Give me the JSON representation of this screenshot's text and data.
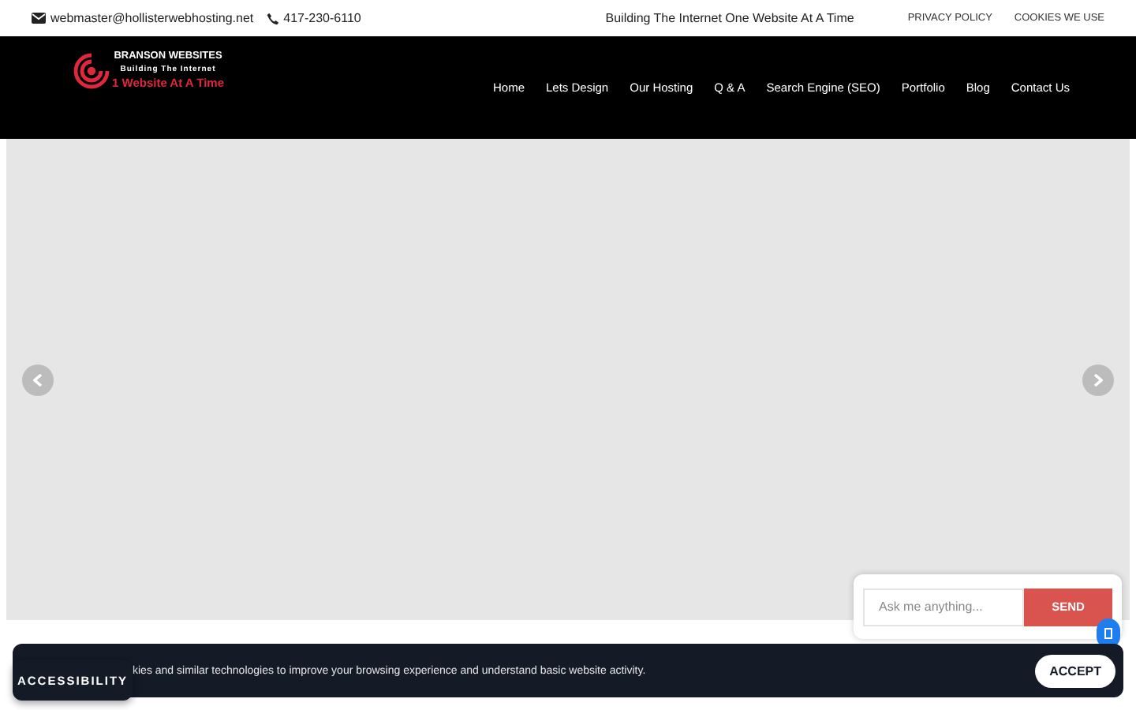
{
  "top_bar": {
    "email": "webmaster@hollisterwebhosting.net",
    "phone": "417-230-6110",
    "tagline": "Building The Internet One Website At A Time",
    "links": [
      "PRIVACY POLICY",
      "COOKIES WE USE"
    ]
  },
  "logo": {
    "title": "BRANSON WEBSITES",
    "line_1": "Building The Internet",
    "line_2": "1 Website At A Time"
  },
  "nav": [
    "Home",
    "Lets Design",
    "Our Hosting",
    "Q & A",
    "Search Engine (SEO)",
    "Portfolio",
    "Blog",
    "Contact Us"
  ],
  "chat": {
    "placeholder": "Ask me anything...",
    "button": "SEND"
  },
  "cookie_banner": {
    "text": "kies and similar technologies to improve your browsing experience and understand basic website activity.",
    "button": "ACCEPT"
  },
  "accessibility_button": "ACCESSIBILITY"
}
